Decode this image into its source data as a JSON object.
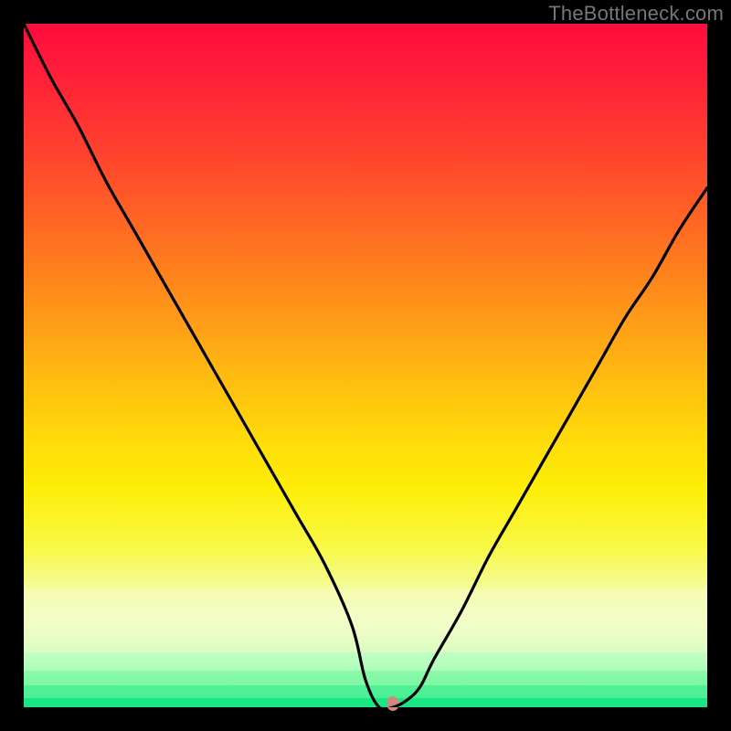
{
  "watermark": "TheBottleneck.com",
  "colors": {
    "frame": "#000000",
    "curve_stroke": "#000000",
    "marker_fill": "#c98a7f",
    "gradient_top": "#ff0b3e",
    "gradient_bottom": "#18e884"
  },
  "chart_data": {
    "type": "line",
    "title": "",
    "xlabel": "",
    "ylabel": "",
    "xlim": [
      0,
      100
    ],
    "ylim": [
      0,
      100
    ],
    "grid": false,
    "legend": false,
    "series": [
      {
        "name": "bottleneck-curve",
        "x": [
          0,
          4,
          8,
          12,
          16,
          20,
          24,
          28,
          32,
          36,
          40,
          44,
          48,
          50,
          52,
          54,
          56,
          58,
          60,
          64,
          68,
          72,
          76,
          80,
          84,
          88,
          92,
          96,
          100
        ],
        "y": [
          100,
          92,
          85,
          77,
          70,
          63,
          56,
          49,
          42,
          35,
          28,
          21,
          12,
          4,
          0,
          0,
          1,
          3,
          7,
          14,
          22,
          29,
          36,
          43,
          50,
          57,
          63,
          70,
          76
        ]
      }
    ],
    "annotations": [
      {
        "name": "optimal-marker",
        "x": 54,
        "y": 0,
        "shape": "ellipse",
        "color": "#c98a7f"
      }
    ],
    "background_bands": [
      {
        "y_from": 18,
        "y_to": 100,
        "kind": "gradient",
        "from_color": "#ff0b3e",
        "to_color": "#f8f94a"
      },
      {
        "y_from": 8,
        "y_to": 18,
        "kind": "pale-yellow",
        "color": "#f7fbc0"
      },
      {
        "y_from": 0,
        "y_to": 8,
        "kind": "green-gradient",
        "from_color": "#d3ffca",
        "to_color": "#18e884"
      }
    ]
  }
}
